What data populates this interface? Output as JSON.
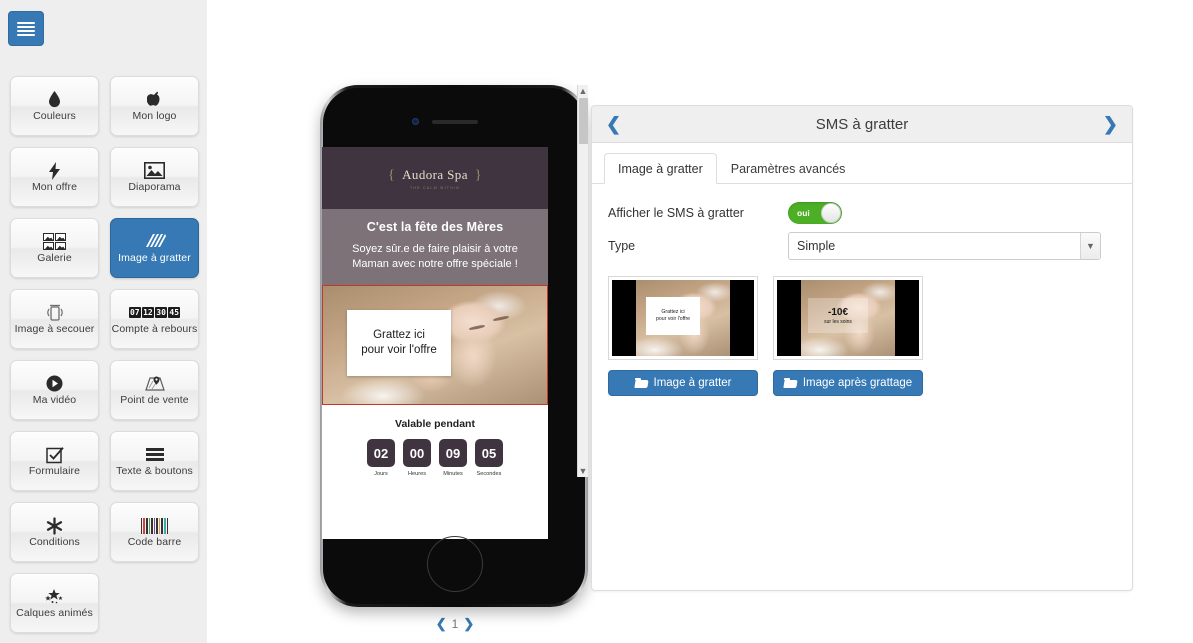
{
  "sidebar": {
    "menu_button_icon": "hamburger-icon",
    "tiles": [
      {
        "label": "Couleurs",
        "icon": "droplet-icon",
        "active": false
      },
      {
        "label": "Mon logo",
        "icon": "apple-icon",
        "active": false
      },
      {
        "label": "Mon offre",
        "icon": "bolt-icon",
        "active": false
      },
      {
        "label": "Diaporama",
        "icon": "slideshow-image-icon",
        "active": false
      },
      {
        "label": "Galerie",
        "icon": "gallery-grid-icon",
        "active": false
      },
      {
        "label": "Image à gratter",
        "icon": "scratch-lines-icon",
        "active": true
      },
      {
        "label": "Image à secouer",
        "icon": "shake-phone-icon",
        "active": false
      },
      {
        "label": "Compte à rebours",
        "icon": "countdown-digits-icon",
        "active": false,
        "digits": [
          "07",
          "12",
          "30",
          "45"
        ]
      },
      {
        "label": "Ma vidéo",
        "icon": "play-circle-icon",
        "active": false
      },
      {
        "label": "Point de vente",
        "icon": "map-pin-icon",
        "active": false
      },
      {
        "label": "Formulaire",
        "icon": "checkbox-icon",
        "active": false
      },
      {
        "label": "Texte & boutons",
        "icon": "text-lines-icon",
        "active": false
      },
      {
        "label": "Conditions",
        "icon": "asterisk-icon",
        "active": false
      },
      {
        "label": "Code barre",
        "icon": "barcode-icon",
        "active": false
      },
      {
        "label": "Calques animés",
        "icon": "sparkle-stars-icon",
        "active": false
      }
    ]
  },
  "preview": {
    "brand": "Audora Spa",
    "brand_brace_left": "{",
    "brand_brace_right": "}",
    "brand_tagline": "THE CALM WITHIN",
    "promo_title": "C'est la fête des Mères",
    "promo_text": "Soyez sûr.e de faire plaisir à votre Maman avec notre offre spéciale !",
    "scratch_text_line1": "Grattez ici",
    "scratch_text_line2": "pour voir l'offre",
    "countdown_title": "Valable pendant",
    "countdown": [
      {
        "value": "02",
        "label": "Jours"
      },
      {
        "value": "00",
        "label": "Heures"
      },
      {
        "value": "09",
        "label": "Minutes"
      },
      {
        "value": "05",
        "label": "Secondes"
      }
    ],
    "pager": {
      "prev": "❮",
      "page": "1",
      "next": "❯"
    }
  },
  "panel": {
    "title": "SMS à gratter",
    "prev_arrow": "❮",
    "next_arrow": "❯",
    "tabs": [
      {
        "label": "Image à gratter",
        "active": true
      },
      {
        "label": "Paramètres avancés",
        "active": false
      }
    ],
    "fields": {
      "display_label": "Afficher le SMS à gratter",
      "toggle_value": "oui",
      "type_label": "Type",
      "type_value": "Simple",
      "type_options": [
        "Simple"
      ]
    },
    "thumb_left": {
      "caption_line1": "Grattez ici",
      "caption_line2": "pour voir l'offre",
      "button_label": "Image à gratter",
      "button_icon": "folder-open-icon"
    },
    "thumb_right": {
      "offer_big": "-10€",
      "offer_small": "sur les soins",
      "button_label": "Image après grattage",
      "button_icon": "folder-open-icon"
    }
  },
  "colors": {
    "accent_blue": "#3779b4",
    "toggle_green": "#4caf26",
    "sidebar_bg": "#eeeeee",
    "panel_head_bg": "#efefef",
    "preview_header_dark": "#3f3440",
    "preview_promo_gray": "#7c7277",
    "scratch_border_red": "#c0392b"
  }
}
